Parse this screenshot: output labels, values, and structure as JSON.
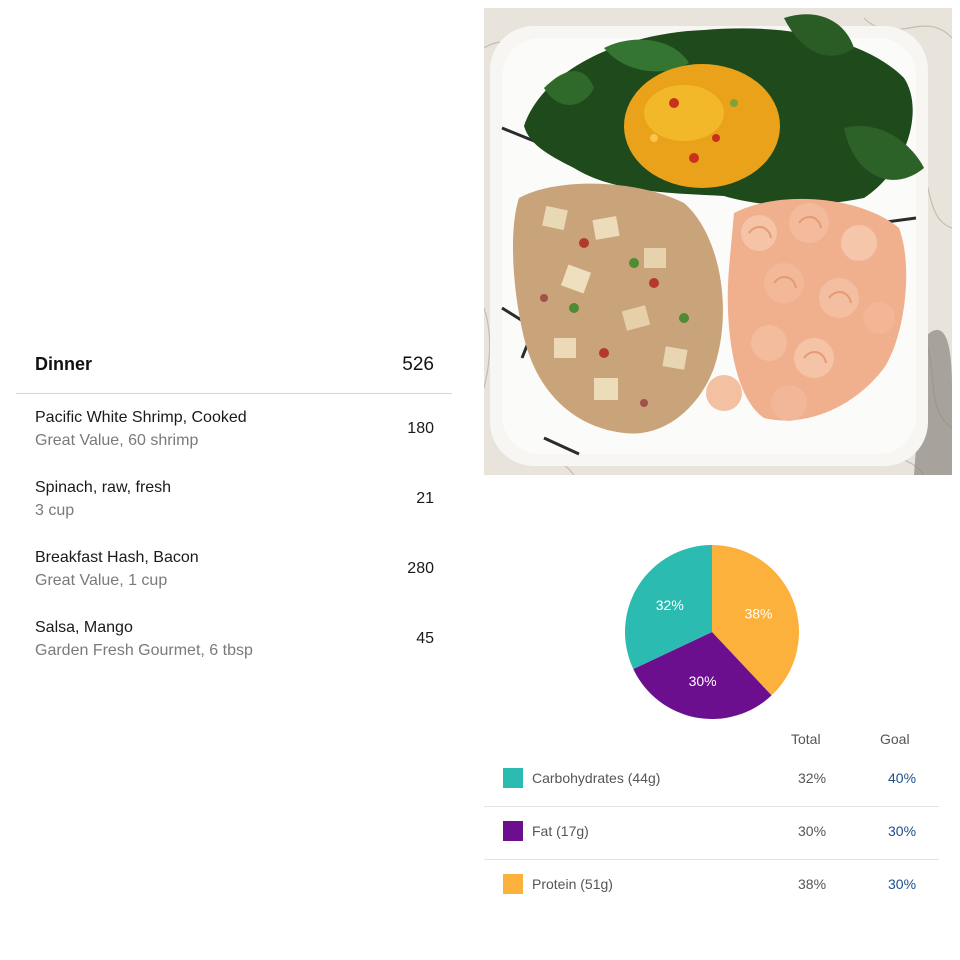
{
  "meal": {
    "title": "Dinner",
    "total_calories": "526",
    "items": [
      {
        "name": "Pacific White Shrimp, Cooked",
        "detail": "Great Value, 60 shrimp",
        "calories": "180"
      },
      {
        "name": "Spinach, raw, fresh",
        "detail": "3 cup",
        "calories": "21"
      },
      {
        "name": "Breakfast Hash, Bacon",
        "detail": "Great Value, 1 cup",
        "calories": "280"
      },
      {
        "name": "Salsa, Mango",
        "detail": "Garden Fresh Gourmet, 6 tbsp",
        "calories": "45"
      }
    ]
  },
  "chart_data": {
    "type": "pie",
    "slices": [
      {
        "label": "Protein",
        "value": 38,
        "display": "38%",
        "color": "#fbb13c"
      },
      {
        "label": "Fat",
        "value": 30,
        "display": "30%",
        "color": "#6b0f8f"
      },
      {
        "label": "Carbohydrates",
        "value": 32,
        "display": "32%",
        "color": "#2bbbb0"
      }
    ]
  },
  "macros": {
    "headers": {
      "total": "Total",
      "goal": "Goal"
    },
    "rows": [
      {
        "name": "Carbohydrates (44g)",
        "total": "32%",
        "goal": "40%",
        "color": "#2bbbb0"
      },
      {
        "name": "Fat (17g)",
        "total": "30%",
        "goal": "30%",
        "color": "#6b0f8f"
      },
      {
        "name": "Protein (51g)",
        "total": "38%",
        "goal": "30%",
        "color": "#fbb13c"
      }
    ]
  }
}
